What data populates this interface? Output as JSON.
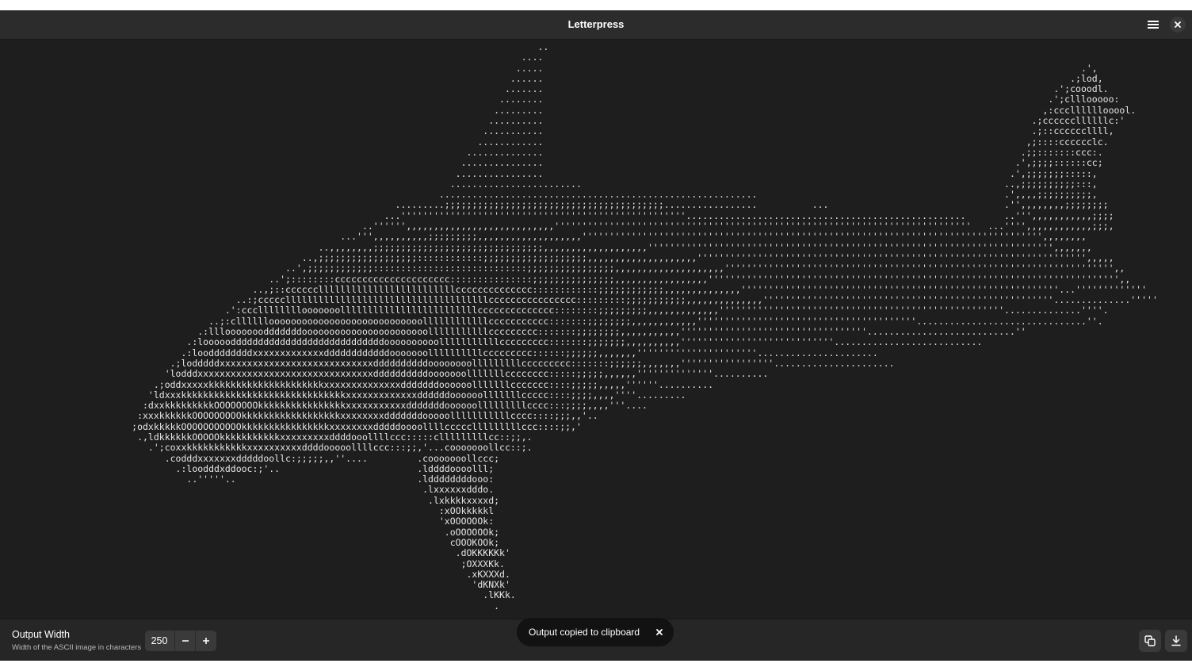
{
  "window": {
    "title": "Letterpress"
  },
  "header": {
    "menu_icon": "hamburger-menu-icon",
    "close_icon": "close-icon"
  },
  "output": {
    "ascii_lines": [
      "                                                                                                  ..",
      "                                                                                               ....",
      "                                                                                              .....                                                                                                  .',",
      "                                                                                             ......                                                                                                .;lod,",
      "                                                                                            .......                                                                                             .';cooodl.",
      "                                                                                           ........                                                                                            .';clllooooo:",
      "                                                                                          .........                                                                                           ,:cccllllllooool.",
      "                                                                                         ..........                                                                                         .;ccccccllllllc:'",
      "                                                                                        ...........                                                                                         .;::ccccccllll,",
      "                                                                                       ............                                                                                        ,;::::cccccclc.",
      "                                                                                     ..............                                                                                       .;;:::::::ccc:.",
      "                                                                                    ...............                                                                                      .',;;;;::::::cc;",
      "                                                                                   ................                                                                                     .',;;;;;;;:::::,",
      "                                                                                  ........................                                                                             ..,;;;;;;;;;;:::,",
      "                                                                                ..........................................................                                             .',,,,;;;;;;;;;;,",
      "                                                                        .........;;;;;;;;;;;;;;;;;;;;;;;;;;;;;;;;;;;;;;;;.................          ...                                .'',,,,,,,,;;;;;;;;",
      "                                                                      ...''''''''''''''''''''''''''''''''''''''''''''''''''''...................................................       ..''',,,,,,,,,,,;;;;",
      "                                                                  ..'''''',,,,,,,,,,,,,,,,,,,,,,,,,,,''''''''''''''''''''''''''''''''''''''''''''''''''''''''''''''''''''''''''''   ...'''',,,,,,,,,,,,;;;,",
      "                                                              ...''',,,,,,,,,,;;;;;;;;;,,,,,,,,,,,,,,,,,,,'''''''''''''''''''''''''''''''''''''''''''''''''''''''''''''''''''''''''''''''''''',,,,,,,,",
      "                                                          ..,,,,,,,,;;;;;;;;;;;;;;;;;;;;;;;;;;;;;;;,,,,,,,,,,,,,,,,,,,'''''''''''''''''''''''''''''''''''''''''''''''''''''''''''''''''''''''''',,,,,,,",
      "                                                       ..,;;;;;;;;;;;;;;;;;;::::::::::::;;;;;;;;;;;;;;;;;;;,,,,,,,,,,,,,,,,,,,,''''''''''''''''''''''''''''''''''''''''''''''''''''''''''''''''''''''',,,,,",
      "                                                    ..',;;;;;;;;;;;;::::::::::::::::::::::::::::;;;;;;;;;;;;;;;;,,,,,,,,,,,,,,,,,,,,''''''''''''''''''''''''''''''''''''''''''''''''''''''''''''''''''''''',,",
      "                                                 ..';::::::::ccccccccccccccccccccc:::::::::::::::;;;;;;;;;;;;;;;,,,,,,,,,,,,,,,,,''''''''''''''''''''''''''''''''''''''''''''''''''''''''''''''''''''''''''',,",
      "                                              ..,;::cccccclllllllllllllllllllllllllcccccccccccccc::::::::::::;;;;;;;;;;;;,,,,,,,,,,,,,,''''''''''''''''''''''''''''''''''''''''''''''''''''''''''...'''''''''''''",
      "                                           ..:;ccccclllllllllllllllllllllllllllllllllllllcccccccccccccccc:::::::::;;;;;;;;;;;,,,,,,,,,,,,,,'''''''''''''''''''''''''''''''''''''''''''''''''''''..............'''''",
      "                                         .':cccllllllllooooooolllllllllllllllllllllllllcccccccccccccc::::::::;;;;;;;;;,,,,,,,,,,,,,''''''''''''''''''''''''''''''''''''''''''''''''''''..............''''.",
      "                                      ..;:clllllloooooooooooooooooooooooooooollllllllllllccccccccccc:::::::;;;;;;;;,,,,,,,,,,,,''''''''''''''''''''''''''''''''''''''''...............................''.",
      "                                    .:lllooooooodddddddooooooooooooooooooooooolllllllllllccccccccc:::::::;;;;;;;;,,,,,,,,,,,''''''''''''''''''''''''''''''''''...........................''",
      "                                  .:loooooddddddddddddddddddddddddddddoooooooooolllllllllllccccccccc:::::::;;;;;;;,,,,,,,,,,''''''''''''''''''''''''''''...........................",
      "                                 .:looddddddddxxxxxxxxxxxxxddddddddddddooooooollllllllllccccccccc::::::;;;;;;,,,,,,,''''''''''''''''''''''......................",
      "                               .;lodddddxxxxxxxxxxxxxxxxxxxxxxxxxxxxddddddddddoooooooolllllllllccccccccc:::::::;;;;;;,,,,,,,'''''''''''''''''......................",
      "                              'lodddxxxxxxxxxxxxxxxxxxxxxxxxxxxxxxxxddddddddddooooooolllllllcccccccc:::::;;;;;,,,,,,''''''''''''''..........",
      "                            .;oddxxxxxkkkkkkkkkkkkkkkkkkkkkxxxxxxxxxxxxxxdddddddoooooolllllllccccccc::::;;;;;,,,,,''''''..........",
      "                           'ldxxxkkkkkkkkkkkkkkkkkkkkkkkkkkkkkkxxxxxxxxxxxxxddddddoooooolllllllccccc::::;;;;,,,,''''.........",
      "                          :dxxkkkkkkkkkOOOOOOOOkkkkkkkkkkkkkkkkxxxxxxxxxxxdddddddoooooolllllllllcccc:::;;;;,,,,'''....",
      "                         :xxxkkkkkkOOOOOOOOOkkkkkkkkkkkkkkkkkkxxxxxxxxdddddddooooolllllllllllcccc::::;;;,,'..",
      "                        ;odxkkkkkOOOOOOOOOOOkkkkkkkkkkkkkkkkxxxxxxxxdddddoooollllccccclllllllllccc::::;;,'",
      "                         .,ldkkkkkkOOOOOkkkkkkkkkkkxxxxxxxxxddddooollllccc:::::clllllllllcc::;;,.",
      "                           .';coxxkkkkkkkkkkkxxxxxxxxxxddddooooollllccc:::;;,'...cooooooollcc::;.",
      "                              .codddxxxxxxxdddddoollc:;;;;;,,''....         .cooooooollccc;",
      "                                .:loodddxddooc:;'..                         .lddddoooolll;",
      "                                  ..'''''..                                 .lddddddddooo:",
      "                                                                             .lxxxxxxdddo.",
      "                                                                              .lxkkkkxxxxd;",
      "                                                                                :xOOkkkkkl",
      "                                                                                'xOOOOOOk:",
      "                                                                                 .oOOOOOOk;",
      "                                                                                  cOOOKOOk;",
      "                                                                                   .dOKKKKKk'",
      "                                                                                    ;OXXXKk.",
      "                                                                                     .xKXXXd.",
      "                                                                                      'dKNXk'",
      "                                                                                        .lKKk.",
      "                                                                                          ."
    ]
  },
  "bottom_bar": {
    "output_width_label": "Output Width",
    "output_width_description": "Width of the ASCII image in characters",
    "width_value": "250",
    "decrement_icon": "minus-icon",
    "increment_icon": "plus-icon",
    "copy_icon": "copy-icon",
    "save_icon": "download-icon"
  },
  "toast": {
    "message": "Output copied to clipboard",
    "close_icon": "close-icon"
  }
}
